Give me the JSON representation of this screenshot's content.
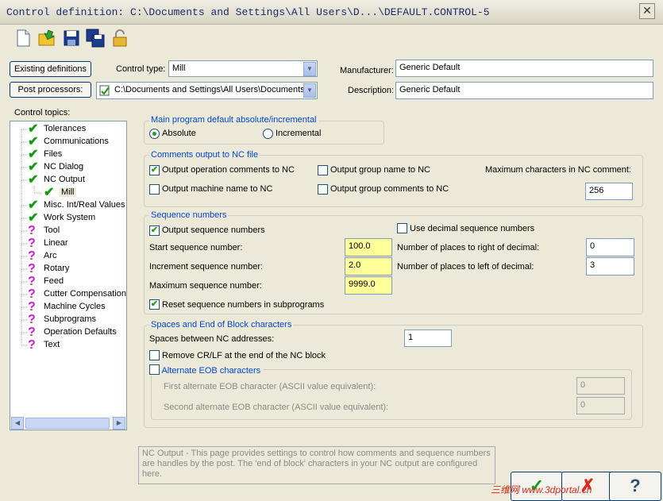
{
  "window": {
    "title": "Control definition: C:\\Documents and Settings\\All Users\\D...\\DEFAULT.CONTROL-5",
    "close_glyph": "✕"
  },
  "toolbar": [
    {
      "name": "new-file-icon",
      "color": "#FFFFFF"
    },
    {
      "name": "open-folder-icon",
      "color": "#F4C430"
    },
    {
      "name": "save-icon",
      "color": "#1E3C8C"
    },
    {
      "name": "save-as-icon",
      "color": "#1E3C8C"
    },
    {
      "name": "lock-icon",
      "color": "#D4A017"
    }
  ],
  "header": {
    "existing_definitions": "Existing definitions",
    "post_processors": "Post processors:",
    "control_type_label": "Control type:",
    "control_type_value": "Mill",
    "path_value": "C:\\Documents and Settings\\All Users\\Documents",
    "manufacturer_label": "Manufacturer:",
    "manufacturer_value": "Generic Default",
    "description_label": "Description:",
    "description_value": "Generic Default"
  },
  "tree": {
    "label": "Control topics:",
    "items": [
      {
        "label": "Tolerances",
        "status": "check"
      },
      {
        "label": "Communications",
        "status": "check"
      },
      {
        "label": "Files",
        "status": "check"
      },
      {
        "label": "NC Dialog",
        "status": "check"
      },
      {
        "label": "NC Output",
        "status": "check"
      },
      {
        "label": "Mill",
        "status": "check"
      },
      {
        "label": "Misc. Int/Real Values",
        "status": "check"
      },
      {
        "label": "Work System",
        "status": "check"
      },
      {
        "label": "Tool",
        "status": "question"
      },
      {
        "label": "Linear",
        "status": "question"
      },
      {
        "label": "Arc",
        "status": "question"
      },
      {
        "label": "Rotary",
        "status": "question"
      },
      {
        "label": "Feed",
        "status": "question"
      },
      {
        "label": "Cutter Compensation",
        "status": "question"
      },
      {
        "label": "Machine Cycles",
        "status": "question"
      },
      {
        "label": "Subprograms",
        "status": "question"
      },
      {
        "label": "Operation Defaults",
        "status": "question"
      },
      {
        "label": "Text",
        "status": "question"
      }
    ],
    "selected": "Mill"
  },
  "main_program": {
    "title": "Main program default absolute/incremental",
    "absolute": "Absolute",
    "incremental": "Incremental",
    "selected": "Absolute"
  },
  "comments": {
    "title": "Comments output to NC file",
    "op_comments": "Output operation comments to NC",
    "group_name": "Output group name to NC",
    "max_chars_label": "Maximum characters in NC comment:",
    "machine_name": "Output machine name to NC",
    "group_comments": "Output group comments to NC",
    "max_chars_value": "256"
  },
  "sequence": {
    "title": "Sequence numbers",
    "output_seq": "Output sequence numbers",
    "use_decimal": "Use decimal sequence numbers",
    "start_label": "Start sequence number:",
    "start_value": "100.0",
    "right_label": "Number of places to right of decimal:",
    "right_value": "0",
    "increment_label": "Increment sequence number:",
    "increment_value": "2.0",
    "left_label": "Number of places to left of decimal:",
    "left_value": "3",
    "max_label": "Maximum sequence number:",
    "max_value": "9999.0",
    "reset": "Reset sequence numbers in subprograms"
  },
  "eob": {
    "title": "Spaces and End of Block characters",
    "spaces_label": "Spaces between NC addresses:",
    "spaces_value": "1",
    "remove_crlf": "Remove CR/LF at the end of the NC block",
    "alternate": "Alternate EOB characters",
    "first_label": "First alternate EOB character (ASCII value equivalent):",
    "first_value": "0",
    "second_label": "Second alternate EOB character (ASCII value equivalent):",
    "second_value": "0"
  },
  "help_text": "NC Output - This page provides settings to control how comments and sequence numbers are handles by the post.  The 'end of block' characters in your NC output are configured here.",
  "buttons": {
    "ok": "✓",
    "cancel": "✗",
    "help": "?"
  },
  "watermark": "三维网 www.3dportal.cn",
  "colors": {
    "check": "#139A13",
    "question": "#D21BD1",
    "required": "#FFFF99",
    "group_title": "#0046D5"
  }
}
